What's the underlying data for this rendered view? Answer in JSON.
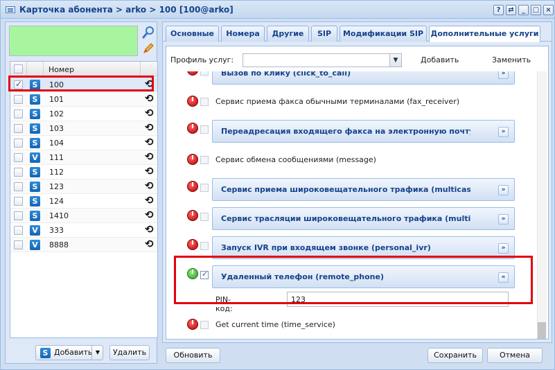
{
  "window": {
    "title": "Карточка абонента > arko > 100 [100@arko]",
    "tools": [
      "?",
      "⇄",
      "_",
      "□",
      "×"
    ]
  },
  "left": {
    "grid_header": "Номер",
    "rows": [
      {
        "type": "S",
        "number": "100",
        "checked": true
      },
      {
        "type": "S",
        "number": "101",
        "checked": false
      },
      {
        "type": "S",
        "number": "102",
        "checked": false
      },
      {
        "type": "S",
        "number": "103",
        "checked": false
      },
      {
        "type": "S",
        "number": "104",
        "checked": false
      },
      {
        "type": "V",
        "number": "111",
        "checked": false
      },
      {
        "type": "S",
        "number": "112",
        "checked": false
      },
      {
        "type": "S",
        "number": "123",
        "checked": false
      },
      {
        "type": "S",
        "number": "124",
        "checked": false
      },
      {
        "type": "S",
        "number": "1410",
        "checked": false
      },
      {
        "type": "V",
        "number": "333",
        "checked": false
      },
      {
        "type": "V",
        "number": "8888",
        "checked": false
      }
    ],
    "add_label": "Добавить",
    "delete_label": "Удалить",
    "add_badge": "S"
  },
  "tabs": [
    {
      "label": "Основные"
    },
    {
      "label": "Номера"
    },
    {
      "label": "Другие"
    },
    {
      "label": "SIP"
    },
    {
      "label": "Модификации SIP"
    },
    {
      "label": "Дополнительные услуги"
    }
  ],
  "profile": {
    "label": "Профиль услуг:",
    "value": "",
    "add_label": "Добавить",
    "replace_label": "Заменить"
  },
  "services": [
    {
      "kind": "panel",
      "title": "Вызов по клику (click_to_call)",
      "enabled": false,
      "checked": false,
      "expand": "»"
    },
    {
      "kind": "text",
      "title": "Сервис приема факса обычными терминалами (fax_receiver)",
      "enabled": false,
      "checked": false
    },
    {
      "kind": "panel",
      "title": "Переадресация входящего факса на электронную почту (fax_",
      "enabled": false,
      "checked": false,
      "expand": "»"
    },
    {
      "kind": "text",
      "title": "Сервис обмена сообщениями (message)",
      "enabled": false,
      "checked": false
    },
    {
      "kind": "panel",
      "title": "Сервис приема широковещательного трафика (multicast_liste",
      "enabled": false,
      "checked": false,
      "expand": "»"
    },
    {
      "kind": "panel",
      "title": "Сервис трасляции широковещательного трафика (multicast_p",
      "enabled": false,
      "checked": false,
      "expand": "»"
    },
    {
      "kind": "panel",
      "title": "Запуск IVR при входящем звонке (personal_ivr)",
      "enabled": false,
      "checked": false,
      "expand": "»"
    },
    {
      "kind": "panel",
      "title": "Удаленный телефон (remote_phone)",
      "enabled": true,
      "checked": true,
      "expand": "«"
    },
    {
      "kind": "text",
      "title": "Get current time (time_service)",
      "enabled": false,
      "checked": false
    }
  ],
  "pin": {
    "label": "PIN-код:",
    "value": "123"
  },
  "footer": {
    "refresh_label": "Обновить",
    "save_label": "Сохранить",
    "cancel_label": "Отмена"
  },
  "colors": {
    "accent": "#15428b",
    "highlight": "#e3000f",
    "search_bg": "#a8f5a0"
  }
}
